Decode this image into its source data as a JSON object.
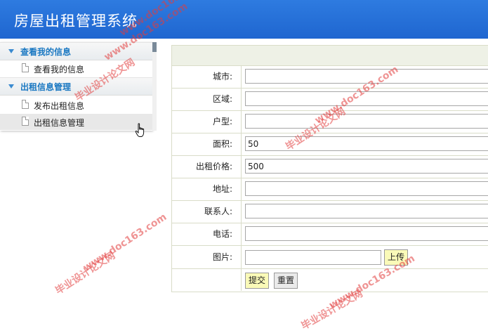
{
  "header": {
    "title": "房屋出租管理系统"
  },
  "sidebar": {
    "groups": [
      {
        "label": "查看我的信息",
        "items": [
          {
            "label": "查看我的信息"
          }
        ]
      },
      {
        "label": "出租信息管理",
        "items": [
          {
            "label": "发布出租信息"
          },
          {
            "label": "出租信息管理"
          }
        ]
      }
    ]
  },
  "form": {
    "city": {
      "label": "城市:",
      "value": ""
    },
    "district": {
      "label": "区域:",
      "value": ""
    },
    "layout": {
      "label": "户型:",
      "value": ""
    },
    "area": {
      "label": "面积:",
      "value": "50"
    },
    "price": {
      "label": "出租价格:",
      "value": "500"
    },
    "address": {
      "label": "地址:",
      "value": ""
    },
    "contact": {
      "label": "联系人:",
      "value": ""
    },
    "phone": {
      "label": "电话:",
      "value": ""
    },
    "image": {
      "label": "图片:",
      "value": "",
      "upload_label": "上传"
    },
    "submit_label": "提交",
    "reset_label": "重置"
  },
  "watermarks": {
    "cn": "毕业设计论文网",
    "url": "www.doc163.com"
  },
  "colors": {
    "header": "#1f66d0",
    "sidebar_group_text": "#1a78c2",
    "yellow_button": "#fafab8",
    "watermark": "#e13c3c"
  }
}
